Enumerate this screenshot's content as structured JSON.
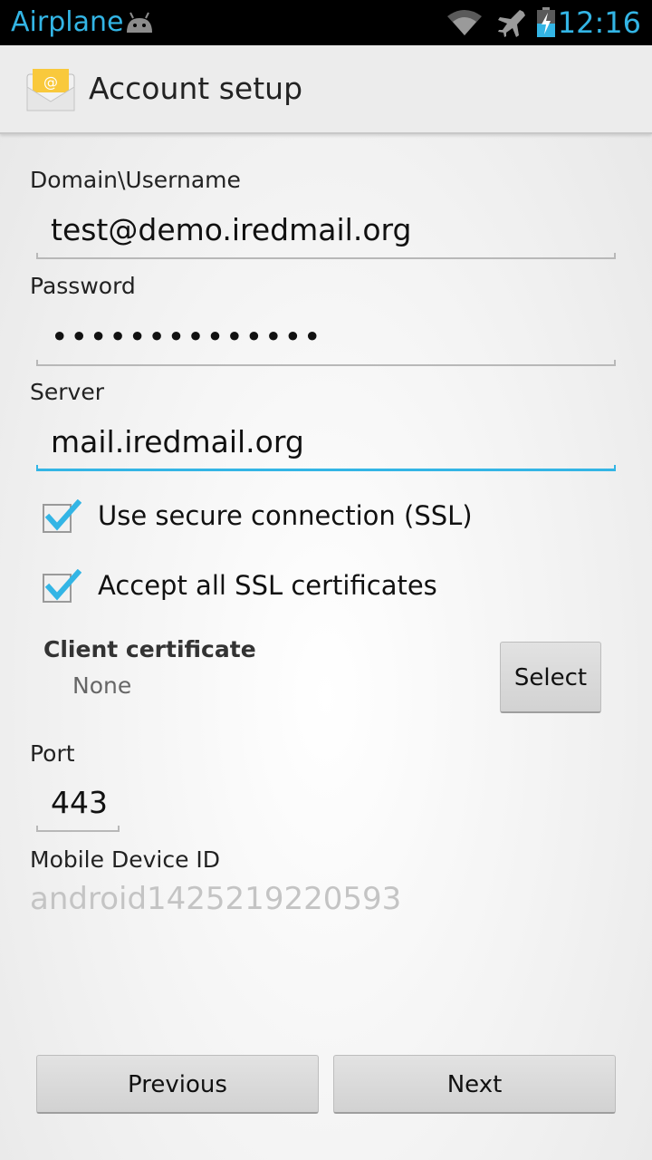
{
  "status_bar": {
    "carrier": "Airplane",
    "time": "12:16",
    "accent_color": "#33b5e5",
    "icons": [
      "android-icon",
      "wifi-icon",
      "airplane-icon",
      "battery-charging-icon"
    ]
  },
  "action_bar": {
    "icon": "email-app-icon",
    "title": "Account setup"
  },
  "form": {
    "username": {
      "label": "Domain\\Username",
      "value": "test@demo.iredmail.org"
    },
    "password": {
      "label": "Password",
      "value": "••••••••••••••"
    },
    "server": {
      "label": "Server",
      "value": "mail.iredmail.org"
    },
    "ssl": {
      "label": "Use secure connection (SSL)",
      "checked": true
    },
    "accept_all": {
      "label": "Accept all SSL certificates",
      "checked": true
    },
    "client_certificate": {
      "title": "Client certificate",
      "value": "None",
      "button": "Select"
    },
    "port": {
      "label": "Port",
      "value": "443"
    },
    "device_id": {
      "label": "Mobile Device ID",
      "value": "android1425219220593"
    }
  },
  "buttons": {
    "previous": "Previous",
    "next": "Next"
  }
}
